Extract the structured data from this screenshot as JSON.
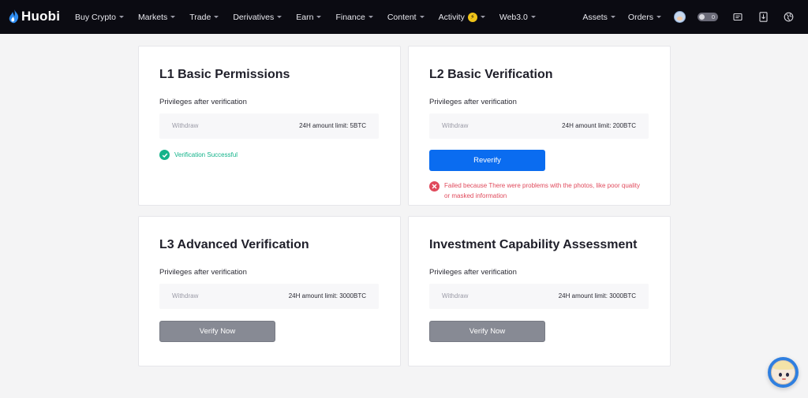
{
  "brand": {
    "name": "Huobi"
  },
  "nav": {
    "items": [
      {
        "label": "Buy Crypto"
      },
      {
        "label": "Markets"
      },
      {
        "label": "Trade"
      },
      {
        "label": "Derivatives"
      },
      {
        "label": "Earn"
      },
      {
        "label": "Finance"
      },
      {
        "label": "Content"
      },
      {
        "label": "Activity"
      },
      {
        "label": "Web3.0"
      }
    ],
    "right": {
      "assets": "Assets",
      "orders": "Orders",
      "toggle_count": "0"
    }
  },
  "cards": [
    {
      "title": "L1 Basic Permissions",
      "subtitle": "Privileges after verification",
      "privilege_label": "Withdraw",
      "privilege_value": "24H amount limit: 5BTC",
      "status_text": "Verification Successful"
    },
    {
      "title": "L2 Basic Verification",
      "subtitle": "Privileges after verification",
      "privilege_label": "Withdraw",
      "privilege_value": "24H amount limit: 200BTC",
      "button_label": "Reverify",
      "error_text_line1": "Failed because There were problems with the photos, like poor quality",
      "error_text_line2": "or masked information"
    },
    {
      "title": "L3 Advanced Verification",
      "subtitle": "Privileges after verification",
      "privilege_label": "Withdraw",
      "privilege_value": "24H amount limit: 3000BTC",
      "button_label": "Verify Now"
    },
    {
      "title": "Investment Capability Assessment",
      "subtitle": "Privileges after verification",
      "privilege_label": "Withdraw",
      "privilege_value": "24H amount limit: 3000BTC",
      "button_label": "Verify Now"
    }
  ],
  "colors": {
    "nav_bg": "#0b0b12",
    "primary_button": "#0a6cf0",
    "disabled_button": "#878a94",
    "success": "#13b38a",
    "error": "#e04a5c",
    "page_bg": "#f4f4f5"
  },
  "icons": {
    "logo": "huobi-flame-icon",
    "activity_badge": "lightning-badge-icon",
    "messages": "message-icon",
    "download": "download-icon",
    "language": "globe-icon",
    "success": "check-circle-icon",
    "error": "x-circle-icon",
    "support": "support-assistant-icon"
  }
}
